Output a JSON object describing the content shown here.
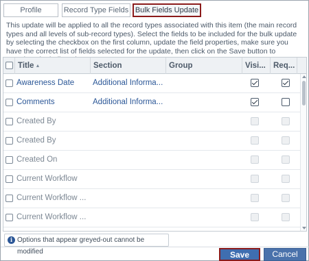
{
  "tabs": [
    {
      "label": "Profile"
    },
    {
      "label": "Record Type Fields"
    },
    {
      "label": "Bulk Fields Update"
    }
  ],
  "description": "This update will be applied to all the record types associated with this item (the main record types and all levels of sub-record types). Select the fields to be included for the bulk update by selecting the checkbox on the first column, update the field properties, make sure you have the correct list of fields selected for the update, then click on the Save button to complete the bulk update.",
  "grid": {
    "columns": [
      "Title",
      "Section",
      "Group",
      "Visi...",
      "Req..."
    ],
    "rows": [
      {
        "title": "Awareness Date",
        "section": "Additional Informa...",
        "visible": true,
        "required": true,
        "enabled": true
      },
      {
        "title": "Comments",
        "section": "Additional Informa...",
        "visible": true,
        "required": false,
        "enabled": true
      },
      {
        "title": "Created By",
        "section": "",
        "visible": false,
        "required": false,
        "enabled": false
      },
      {
        "title": "Created By",
        "section": "",
        "visible": false,
        "required": false,
        "enabled": false
      },
      {
        "title": "Created On",
        "section": "",
        "visible": false,
        "required": false,
        "enabled": false
      },
      {
        "title": "Current Workflow",
        "section": "",
        "visible": false,
        "required": false,
        "enabled": false
      },
      {
        "title": "Current Workflow ...",
        "section": "",
        "visible": false,
        "required": false,
        "enabled": false
      },
      {
        "title": "Current Workflow ...",
        "section": "",
        "visible": false,
        "required": false,
        "enabled": false
      }
    ]
  },
  "info_note": "Options that appear greyed-out cannot be modified",
  "buttons": {
    "save": "Save",
    "cancel": "Cancel"
  },
  "colors": {
    "accent": "#2b5797",
    "highlight_border": "#8b1a1a",
    "button_bg": "#3f6eb0"
  }
}
